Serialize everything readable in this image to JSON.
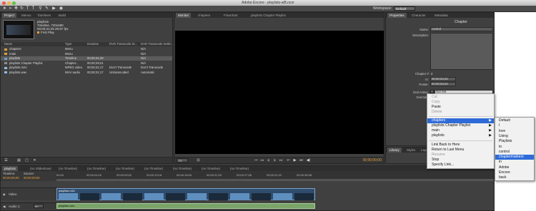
{
  "app": {
    "title": "Adobe Encore - playlists-wB.ncor"
  },
  "toolbar": {
    "workspace_label": "Workspace:",
    "workspace_value": "Default"
  },
  "project_panel": {
    "tabs": [
      "Project",
      "Menus",
      "Timelines",
      "Build"
    ],
    "preview": {
      "name": "playlists",
      "line1": "Timeline, 720x480",
      "line2": "00;00;31;29 29.97 fps",
      "line3": "First Play"
    },
    "columns": [
      "Name",
      "Type",
      "Duration",
      "DVD Transcode St...",
      "DVD Transcode Settin..."
    ],
    "rows": [
      {
        "name": "chapters",
        "type": "Menu",
        "duration": "",
        "status": "",
        "settings": "N/A",
        "icon_color": "#d9a43c"
      },
      {
        "name": "main",
        "type": "Menu",
        "duration": "",
        "status": "",
        "settings": "N/A",
        "icon_color": "#d9a43c"
      },
      {
        "name": "playlists",
        "type": "Timeline",
        "duration": "00;00;31;29",
        "status": "",
        "settings": "N/A",
        "icon_color": "#6fa1d8"
      },
      {
        "name": "playlists Chapter Playlist",
        "type": "Chapter...",
        "duration": "00;00;29;21",
        "status": "",
        "settings": "N/A",
        "icon_color": "#8f8f8f"
      },
      {
        "name": "playlists.m2v",
        "type": "MPEG video",
        "duration": "00;00;31;17",
        "status": "Don't Transcode",
        "settings": "Don't Transcode",
        "icon_color": "#8fbce6"
      },
      {
        "name": "playlists.wav",
        "type": "WAV audio",
        "duration": "00;00;31;17",
        "status": "Untranscoded",
        "settings": "Automatic",
        "icon_color": "#8fbce6"
      }
    ]
  },
  "monitor_panel": {
    "tabs": [
      "Monitor",
      "chapters",
      "Flowchart",
      "playlists Chapter Playlist"
    ],
    "timecode": "00;00;00;00",
    "zoom": "Fit"
  },
  "properties_panel": {
    "tabs": [
      "Properties",
      "Character",
      "Metadata"
    ],
    "type_label": "Chapter",
    "name_label": "Name:",
    "name_value": "control",
    "description_label": "Description:",
    "chapter_num_label": "Chapter #:",
    "chapter_num_value": "2",
    "in_label": "In:",
    "in_value": "00;00;03;23",
    "poster_label": "Poster:",
    "poster_value": "00;00;03;23",
    "end_action_label": "End Action:",
    "end_action_value": "Not Set",
    "override_label": "Override:"
  },
  "context_menu": {
    "items": [
      "Cut",
      "Copy",
      "Paste",
      "Delete"
    ],
    "targets": [
      "chapters",
      "playlists Chapter Playlist",
      "main",
      "playlists"
    ],
    "actions": [
      "Link Back to Here",
      "Return to Last Menu",
      "Resume",
      "Stop",
      "Specify Link..."
    ]
  },
  "submenu": {
    "items": [
      "Default",
      "I",
      "love",
      "Using",
      "Playlists",
      "to",
      "control",
      "chaptermarkers",
      "in",
      "Adobe",
      "Encore",
      "back"
    ]
  },
  "library_panel": {
    "tabs": [
      "Library",
      "Styles",
      "Layers"
    ]
  },
  "timeline_panel": {
    "tabs": [
      "playlists",
      "(no Slideshow)",
      "(no Timeline)",
      "(no Timeline)",
      "(no Timeline)",
      "(no Timeline)",
      "(no Timeline)",
      "(no Timeline)",
      "(no Timeline)"
    ],
    "timeline_label": "Timeline:",
    "source_label": "Source:",
    "timeline_tc": "00;00;00;00",
    "source_tc": "00;00;00;00",
    "ruler": [
      "00;00",
      "00;00;04;16",
      "00;00;09;02",
      "00;00;13;18",
      "00;00;18;04",
      "00;00;22;20",
      "00;00;27;06",
      "00;00;31;22",
      "00;00;36;08"
    ],
    "video_track": "Video",
    "video_clip": "playlists.m2v",
    "audio_track": "Audio 1:",
    "audio_lang": "en",
    "audio_clip": "playlists.wav"
  }
}
